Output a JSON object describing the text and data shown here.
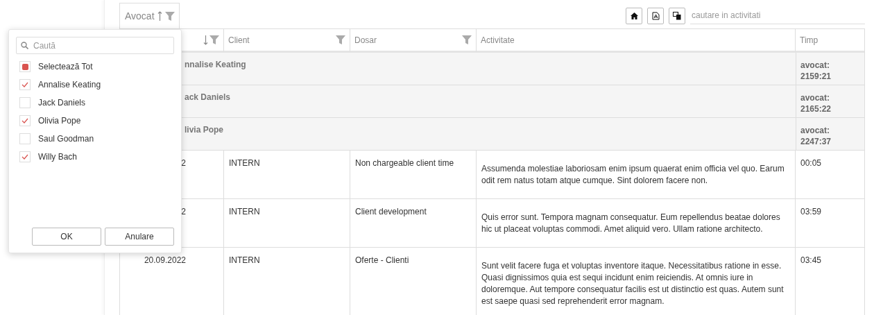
{
  "toolbar": {
    "group_chip": {
      "label": "Avocat",
      "sorted": true,
      "descending": false,
      "filter": true
    },
    "search": {
      "placeholder": "cautare in activitati"
    }
  },
  "table": {
    "columns": [
      {
        "sorted": true,
        "descending": true,
        "filter": true
      },
      {
        "label": "Client",
        "sorted": false,
        "filter": true
      },
      {
        "label": "Dosar",
        "sorted": false,
        "filter": true
      },
      {
        "label": "Activitate",
        "sorted": false,
        "filter": false
      },
      {
        "label": "Timp",
        "sorted": false,
        "filter": false
      }
    ],
    "groups": [
      {
        "label": "nnalise Keating",
        "total": "avocat: 2159:21"
      },
      {
        "label": "ack Daniels",
        "total": "avocat: 2165:22"
      },
      {
        "label": "livia Pope",
        "total": "avocat: 2247:37"
      }
    ],
    "rows": [
      {
        "date": "2",
        "client": "INTERN",
        "dosar": "Non chargeable client time",
        "activity": "Assumenda molestiae laboriosam enim ipsum quaerat enim officia vel quo. Earum odit rem natus totam atque cumque. Sint dolorem facere non.",
        "time": "00:05"
      },
      {
        "date": "2",
        "client": "INTERN",
        "dosar": "Client development",
        "activity": "Quis error sunt. Tempora magnam consequatur. Eum repellendus beatae dolores hic ut placeat voluptas commodi. Amet aliquid vero. Ullam ratione architecto.",
        "time": "03:59"
      },
      {
        "date": "20.09.2022",
        "client": "INTERN",
        "dosar": "Oferte - Clienti",
        "activity": "Sunt velit facere fuga et voluptas inventore itaque. Necessitatibus ratione in esse. Quasi dignissimos quia est sequi incidunt enim reiciendis. At omnis iure in doloremque. Aut tempore consequatur facilis est ut distinctio est quas. Autem sunt est saepe quasi sed reprehenderit error magnam.",
        "time": "03:45"
      }
    ]
  },
  "filter_popup": {
    "search": {
      "placeholder": "Caută"
    },
    "select_all": {
      "label": "Selectează Tot",
      "indeterminate": true
    },
    "items": [
      {
        "label": "Annalise Keating",
        "checked": true
      },
      {
        "label": "Jack Daniels",
        "checked": false
      },
      {
        "label": "Olivia Pope",
        "checked": true
      },
      {
        "label": "Saul Goodman",
        "checked": false
      },
      {
        "label": "Willy Bach",
        "checked": true
      }
    ],
    "buttons": [
      "OK",
      "Anulare"
    ]
  }
}
